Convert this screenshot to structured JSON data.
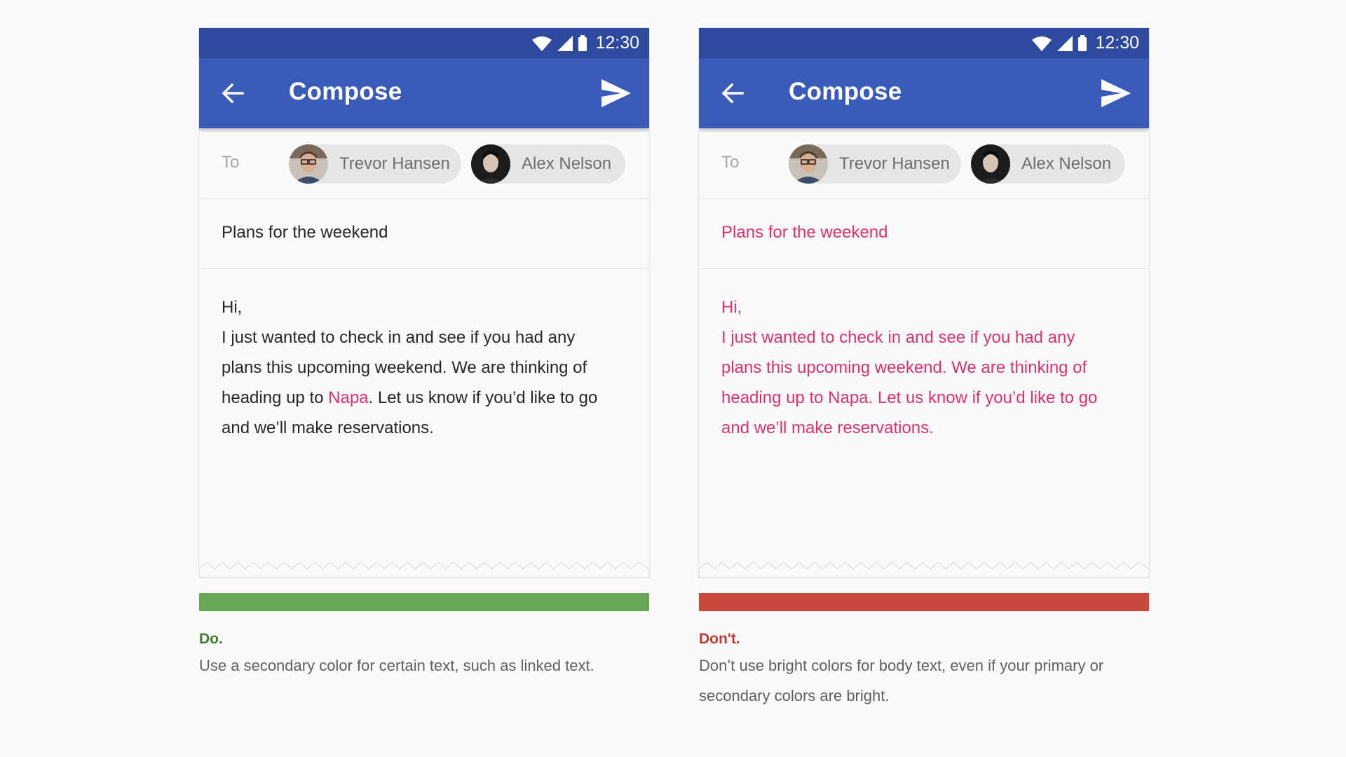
{
  "colors": {
    "status_bar": "#2d4a9e",
    "app_bar": "#3a5bb7",
    "accent_pink": "#e0306a",
    "do_bar": "#6aa755",
    "dont_bar": "#c9483b",
    "do_text": "#3d7d2f",
    "dont_text": "#c0392b"
  },
  "examples": {
    "do": {
      "status_time": "12:30",
      "title": "Compose",
      "to_label": "To",
      "recipients": [
        "Trevor Hansen",
        "Alex Nelson"
      ],
      "subject": "Plans for the weekend",
      "body": {
        "greeting": "Hi,",
        "line1": "I just wanted to check in and see if you had any",
        "line2": "plans this upcoming weekend. We are thinking of",
        "line3_before": "heading up to ",
        "line3_link": "Napa",
        "line3_after": ". Let us know if you’d like to go",
        "line4": "and we’ll make reservations."
      },
      "caption_title": "Do.",
      "caption_text": "Use a secondary color for certain text, such as linked text."
    },
    "dont": {
      "status_time": "12:30",
      "title": "Compose",
      "to_label": "To",
      "recipients": [
        "Trevor Hansen",
        "Alex Nelson"
      ],
      "subject": "Plans for the weekend",
      "body": {
        "greeting": "Hi,",
        "line1": "I just wanted to check in and see if you had any",
        "line2": "plans this upcoming weekend. We are thinking of",
        "line3": "heading up to Napa. Let us know if you’d like to go",
        "line4": "and we’ll make reservations."
      },
      "caption_title": "Don't.",
      "caption_text": "Don’t use bright colors for body text, even if your primary or secondary colors are bright."
    }
  }
}
